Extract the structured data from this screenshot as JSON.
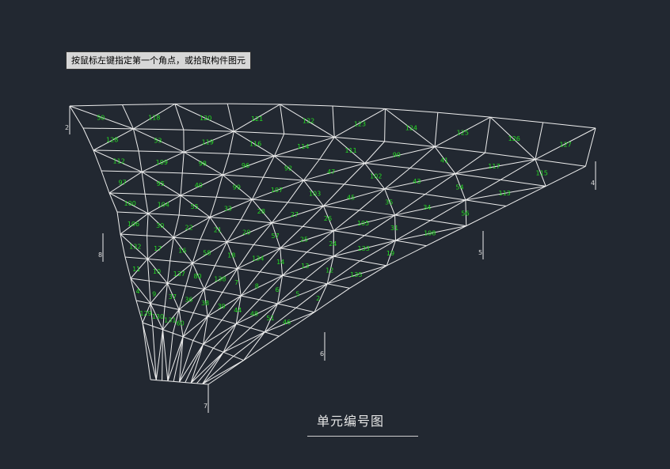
{
  "command_prompt": "按鼠标左键指定第一个角点，或拾取构件图元",
  "drawing_title": "单元编号图",
  "colors": {
    "background": "#222831",
    "member_line": "#eeeeee",
    "member_label": "#22dd22",
    "support_label": "#dddddd"
  },
  "element_labels": [
    "50",
    "118",
    "120",
    "121",
    "122",
    "123",
    "124",
    "125",
    "126",
    "127",
    "128",
    "53",
    "119",
    "116",
    "114",
    "111",
    "90",
    "41",
    "117",
    "115",
    "112",
    "109",
    "98",
    "96",
    "92",
    "47",
    "102",
    "43",
    "54",
    "113",
    "97",
    "95",
    "40",
    "99",
    "107",
    "103",
    "45",
    "35",
    "34",
    "56",
    "100",
    "104",
    "55",
    "33",
    "28",
    "27",
    "26",
    "105",
    "31",
    "108",
    "106",
    "30",
    "22",
    "21",
    "20",
    "57",
    "25",
    "24",
    "133",
    "19",
    "132",
    "17",
    "16",
    "58",
    "18",
    "134",
    "14",
    "13",
    "12",
    "135",
    "11",
    "10",
    "137",
    "80",
    "138",
    "7",
    "8",
    "6",
    "5",
    "2",
    "4",
    "9",
    "37",
    "36",
    "38",
    "39",
    "44",
    "48",
    "51",
    "46",
    "129",
    "130",
    "131",
    "60"
  ],
  "support_labels": [
    "2",
    "4",
    "5",
    "6",
    "7",
    "8"
  ]
}
